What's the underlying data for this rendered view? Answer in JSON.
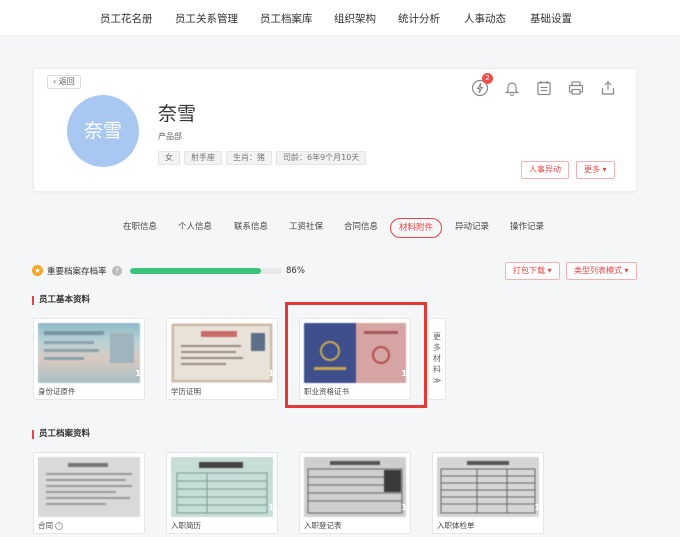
{
  "nav": {
    "items": [
      "员工花名册",
      "员工关系管理",
      "员工档案库",
      "组织架构",
      "统计分析",
      "人事动态",
      "基础设置"
    ]
  },
  "profile": {
    "back_label": "返回",
    "avatar_text": "奈雪",
    "name": "奈雪",
    "department": "产品部",
    "tags": [
      "女",
      "射手座",
      "生肖：猪",
      "司龄：6年9个月10天"
    ],
    "notification_count": "2",
    "action_change": "人事异动",
    "action_more": "更多 ▾"
  },
  "tabs": {
    "items": [
      "在职信息",
      "个人信息",
      "联系信息",
      "工资社保",
      "合同信息",
      "材料附件",
      "异动记录",
      "操作记录"
    ],
    "active_index": 5
  },
  "archive": {
    "label": "重要档案存档率",
    "percent_value": 86,
    "percent_text": "86%",
    "pack_download": "打包下载 ▾",
    "view_mode": "类型列表模式 ▾"
  },
  "sections": {
    "basic_title": "员工基本资料",
    "file_title": "员工档案资料",
    "more_label": [
      "更",
      "多",
      "材",
      "料",
      "≫"
    ]
  },
  "basic_docs": [
    {
      "label": "身份证原件",
      "count": "1"
    },
    {
      "label": "学历证明",
      "count": "1"
    },
    {
      "label": "职业资格证书",
      "count": "1"
    }
  ],
  "file_docs": [
    {
      "label": "合同",
      "count": ""
    },
    {
      "label": "入职简历",
      "count": "1"
    },
    {
      "label": "入职登记表",
      "count": "1"
    },
    {
      "label": "入职体检单",
      "count": "1"
    }
  ],
  "colors": {
    "accent": "#e64545",
    "progress": "#3cc37a",
    "avatar": "#a8c8f2",
    "highlight": "#e53935"
  }
}
